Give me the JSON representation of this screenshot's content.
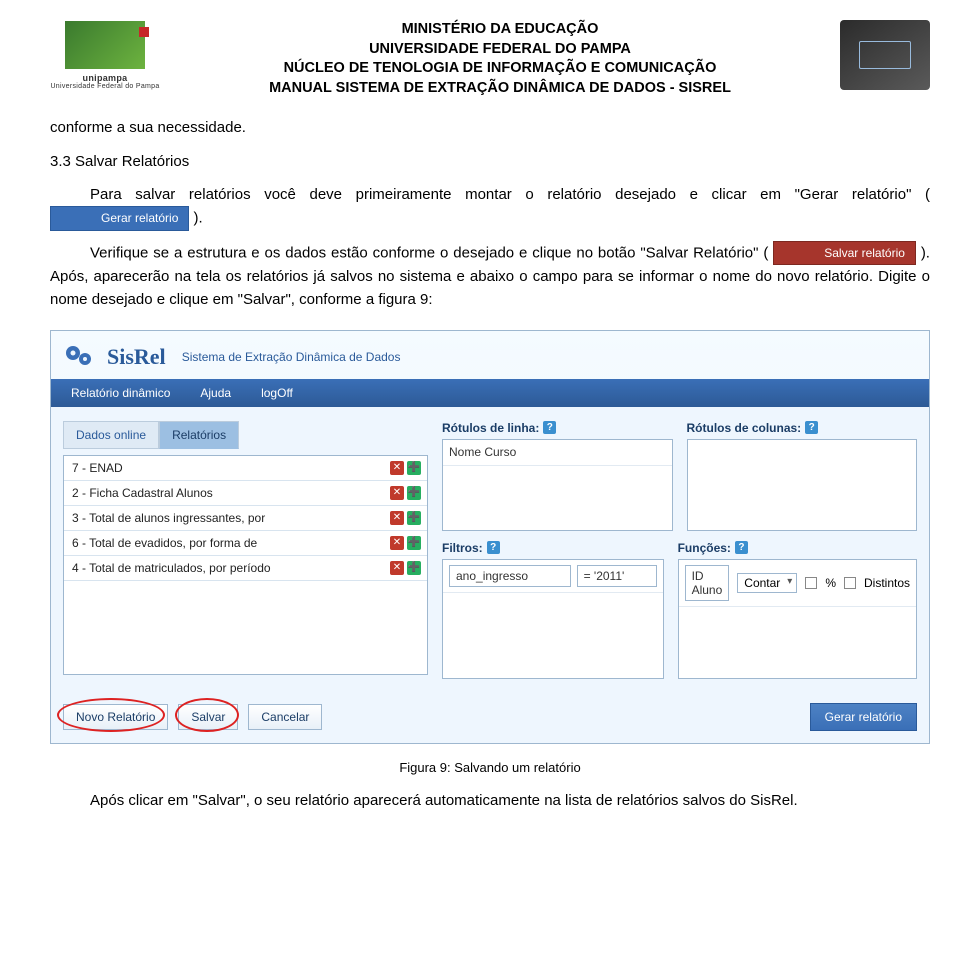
{
  "header": {
    "line1": "MINISTÉRIO DA EDUCAÇÃO",
    "line2": "UNIVERSIDADE FEDERAL DO PAMPA",
    "line3": "NÚCLEO DE TENOLOGIA DE INFORMAÇÃO E COMUNICAÇÃO",
    "line4": "MANUAL SISTEMA DE EXTRAÇÃO DINÂMICA DE DADOS - SISREL",
    "logo_left_caption": "unipampa",
    "logo_left_sub": "Universidade Federal do Pampa"
  },
  "doc": {
    "p0": "conforme a sua necessidade.",
    "h1": "3.3 Salvar Relatórios",
    "p1_a": "Para salvar relatórios você deve primeiramente montar o relatório desejado e clicar em \"Gerar relatório\" (",
    "p1_btn": "Gerar relatório",
    "p1_b": ").",
    "p2_a": "Verifique se a estrutura e os dados estão conforme o desejado e clique no botão \"Salvar Relatório\" (",
    "p2_btn": "Salvar relatório",
    "p2_b": "). Após, aparecerão na tela os relatórios já salvos no sistema e abaixo o campo para se informar o nome do novo relatório. Digite o nome desejado e clique em \"Salvar\", conforme a figura 9:",
    "fig_caption": "Figura 9: Salvando um relatório",
    "p3": "Após clicar em \"Salvar\", o seu relatório aparecerá automaticamente na lista de relatórios salvos do SisRel."
  },
  "app": {
    "title": "SisRel",
    "subtitle": "Sistema de Extração Dinâmica de Dados",
    "menu": {
      "m0": "Relatório dinâmico",
      "m1": "Ajuda",
      "m2": "logOff"
    },
    "tabs": {
      "t0": "Dados online",
      "t1": "Relatórios"
    },
    "reports": {
      "r0": "7 - ENAD",
      "r1": "2 - Ficha Cadastral Alunos",
      "r2": "3 - Total de alunos ingressantes, por",
      "r3": "6 - Total de evadidos, por forma de",
      "r4": "4 - Total de matriculados, por período"
    },
    "labels": {
      "rows": "Rótulos de linha:",
      "cols": "Rótulos de colunas:",
      "filters": "Filtros:",
      "funcs": "Funções:"
    },
    "rows_item0": "Nome Curso",
    "filter": {
      "field": "ano_ingresso",
      "op": "= '2011'"
    },
    "func": {
      "field": "ID Aluno",
      "agg": "Contar",
      "pct": "%",
      "distinct": "Distintos"
    },
    "footer": {
      "novo": "Novo Relatório",
      "salvar": "Salvar",
      "cancelar": "Cancelar",
      "gerar": "Gerar relatório"
    }
  }
}
